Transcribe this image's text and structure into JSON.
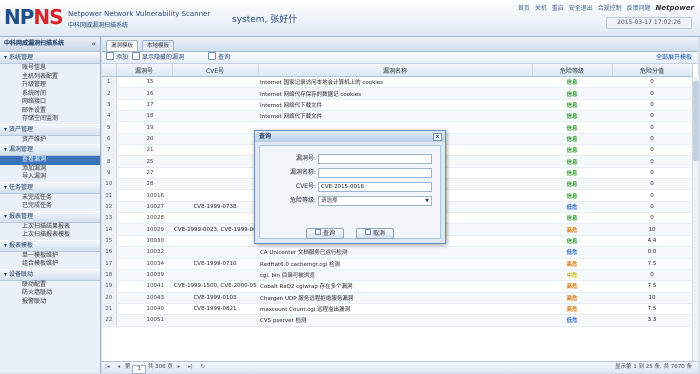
{
  "header": {
    "logo_main": "NP",
    "logo_accent": "NS",
    "brand_en": "Netpower Network Vulnerability Scanner",
    "brand_cn": "中科网威漏洞扫描系统",
    "system_user": "system, 张好什",
    "nav": [
      "首页",
      "关机",
      "重启",
      "安全退出",
      "合规控制",
      "反馈问题"
    ],
    "nav_brand": "Netpower",
    "clock": "2015-03-17 17:02:26"
  },
  "sidebar": {
    "title": "中科网威漏洞扫描系统",
    "collapse": "«",
    "groups": [
      {
        "label": "系统管理",
        "items": [
          "账号信息",
          "主机列表配置",
          "升级管理",
          "系统时间",
          "网络接口",
          "邮件设置",
          "存储空间监测"
        ]
      },
      {
        "label": "资产管理",
        "items": [
          "资产维护"
        ]
      },
      {
        "label": "漏洞管理",
        "items": [
          "查看漏洞",
          "添加漏洞",
          "导入漏洞"
        ]
      },
      {
        "label": "任务管理",
        "items": [
          "未完成任务",
          "已完成任务"
        ]
      },
      {
        "label": "报表管理",
        "items": [
          "上次扫描结果报表",
          "上次扫描报表模板"
        ]
      },
      {
        "label": "报表模板",
        "items": [
          "单一模板维护",
          "组合模板维护"
        ]
      },
      {
        "label": "设备联动",
        "items": [
          "联动配置",
          "防火墙联动",
          "报警联动"
        ]
      }
    ],
    "active_item": "查看漏洞"
  },
  "tabs": [
    "漏洞模板",
    "本地模板"
  ],
  "toolbar": {
    "add": "添加",
    "show_hidden": "显示隐藏的漏洞",
    "query": "查询",
    "expand_all": "全部展开模板"
  },
  "table": {
    "headers": [
      "",
      "漏洞号",
      "CVE号",
      "漏洞名称",
      "危险等级",
      "危险分值"
    ],
    "rows": [
      {
        "n": "1",
        "id": "15",
        "cve": "",
        "name": "Internet 国家记录访问本地会计算机上的 cookies",
        "level": "信息",
        "score": "0"
      },
      {
        "n": "2",
        "id": "16",
        "cve": "",
        "name": "Internet 网络代存保存的数据记 cookies",
        "level": "信息",
        "score": "0"
      },
      {
        "n": "3",
        "id": "17",
        "cve": "",
        "name": "Internet 网络代下载文件",
        "level": "信息",
        "score": "0"
      },
      {
        "n": "4",
        "id": "18",
        "cve": "",
        "name": "Internet 网络代下载文件",
        "level": "信息",
        "score": "0"
      },
      {
        "n": "5",
        "id": "19",
        "cve": "",
        "name": "",
        "level": "信息",
        "score": "0"
      },
      {
        "n": "6",
        "id": "20",
        "cve": "",
        "name": "",
        "level": "信息",
        "score": "0"
      },
      {
        "n": "7",
        "id": "21",
        "cve": "",
        "name": "",
        "level": "信息",
        "score": "0"
      },
      {
        "n": "8",
        "id": "25",
        "cve": "",
        "name": "",
        "level": "信息",
        "score": "0"
      },
      {
        "n": "9",
        "id": "27",
        "cve": "",
        "name": "",
        "level": "信息",
        "score": "0"
      },
      {
        "n": "10",
        "id": "28",
        "cve": "",
        "name": "",
        "level": "信息",
        "score": "0"
      },
      {
        "n": "11",
        "id": "10016",
        "cve": "",
        "name": "",
        "level": "信息",
        "score": "0"
      },
      {
        "n": "12",
        "id": "10027",
        "cve": "CVE-1999-0738",
        "name": "意文件访问漏洞",
        "level": "低危",
        "score": "0"
      },
      {
        "n": "13",
        "id": "10028",
        "cve": "",
        "name": "",
        "level": "信息",
        "score": "0"
      },
      {
        "n": "14",
        "id": "10029",
        "cve": "CVE-1999-0023, CVE-1999-00",
        "name": "IRC BOOD 服务几 v.0.1 BELiG.S.2.0 存在缓冲区溢出漏洞利用",
        "level": "高危",
        "score": "10"
      },
      {
        "n": "15",
        "id": "10030",
        "cve": "",
        "name": "CA Unicenter 文件传输服务已运行检测",
        "level": "信息",
        "score": "4.4"
      },
      {
        "n": "16",
        "id": "10032",
        "cve": "",
        "name": "CA Unicenter 文档服务已运行检测",
        "level": "低危",
        "score": "0.0"
      },
      {
        "n": "17",
        "id": "10034",
        "cve": "CVE-1999-0710",
        "name": "RedHat6.0 cachemgr.cgi 检测",
        "level": "高危",
        "score": "7.5"
      },
      {
        "n": "18",
        "id": "10039",
        "cve": "",
        "name": "cgi. bin 目录可被浏览",
        "level": "中危",
        "score": "0"
      },
      {
        "n": "19",
        "id": "10041",
        "cve": "CVE-1999-1500, CVE-2000-05",
        "name": "Cobalt RaQ2 cgiwrap 存在多个漏洞",
        "level": "高危",
        "score": "7.5"
      },
      {
        "n": "20",
        "id": "10043",
        "cve": "CVE-1999-0103",
        "name": "Chargen UDP 服务远程拒绝服务漏洞",
        "level": "高危",
        "score": "10"
      },
      {
        "n": "21",
        "id": "10049",
        "cve": "CVE-1999-0821",
        "name": "maxcount Count.cgi 远程溢出漏洞",
        "level": "高危",
        "score": "7.5"
      },
      {
        "n": "22",
        "id": "10051",
        "cve": "",
        "name": "CVS pserver 检测",
        "level": "低危",
        "score": "3.3"
      }
    ]
  },
  "level_colors": {
    "信息": "#3aa03a",
    "低危": "#2f6fd0",
    "中危": "#d6c200",
    "高危": "#e07a10"
  },
  "pager": {
    "page_label_pre": "第",
    "page": "1",
    "page_label_post": "共 306 页",
    "info": "显示第 1 到 25 条, 共 7670 条"
  },
  "modal": {
    "title": "查询",
    "close": "x",
    "fields": {
      "vuln_id_label": "漏洞号:",
      "vuln_name_label": "漏洞名称:",
      "cve_label": "CVE号:",
      "cve_value": "CVE-2015-0016",
      "level_label": "危险等级:",
      "level_value": "请选择"
    },
    "query_btn": "查询",
    "cancel_btn": "取消"
  }
}
